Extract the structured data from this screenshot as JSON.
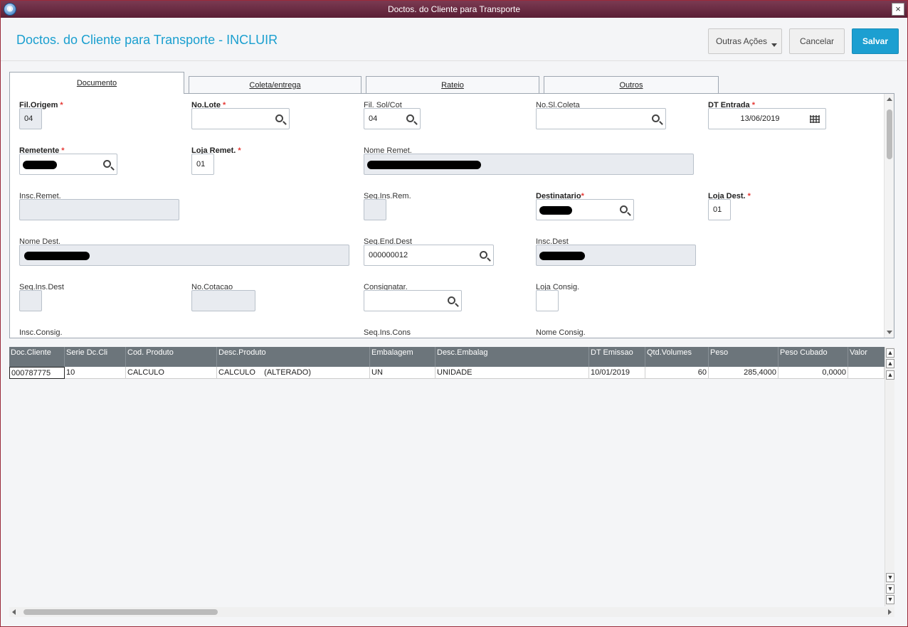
{
  "window": {
    "title": "Doctos. do Cliente para Transporte",
    "close_glyph": "×",
    "app_icon": "app-logo-icon"
  },
  "header": {
    "title": "Doctos. do Cliente para Transporte - INCLUIR",
    "buttons": {
      "more_actions": "Outras Ações",
      "cancel": "Cancelar",
      "save": "Salvar"
    }
  },
  "tabs": [
    "Documento",
    "Coleta/entrega",
    "Rateio",
    "Outros"
  ],
  "form": {
    "fil_origem": {
      "label": "Fil.Origem",
      "value": "04"
    },
    "no_lote": {
      "label": "No.Lote",
      "value": ""
    },
    "fil_sol_cot": {
      "label": "Fil. Sol/Cot",
      "value": "04"
    },
    "no_sl_coleta": {
      "label": "No.Sl.Coleta",
      "value": ""
    },
    "dt_entrada": {
      "label": "DT Entrada",
      "value": "13/06/2019"
    },
    "remetente": {
      "label": "Remetente"
    },
    "loja_remet": {
      "label": "Loja Remet.",
      "value": "01"
    },
    "nome_remet": {
      "label": "Nome Remet."
    },
    "insc_remet": {
      "label": "Insc.Remet."
    },
    "seq_ins_rem": {
      "label": "Seq.Ins.Rem."
    },
    "destinatario": {
      "label": "Destinatario"
    },
    "loja_dest": {
      "label": "Loja Dest.",
      "value": "01"
    },
    "nome_dest": {
      "label": "Nome Dest."
    },
    "seq_end_dest": {
      "label": "Seq.End.Dest",
      "value": "000000012"
    },
    "insc_dest": {
      "label": "Insc.Dest"
    },
    "seq_ins_dest": {
      "label": "Seq.Ins.Dest"
    },
    "no_cotacao": {
      "label": "No.Cotacao"
    },
    "consignatar": {
      "label": "Consignatar.",
      "value": ""
    },
    "loja_consig": {
      "label": "Loja Consig.",
      "value": ""
    },
    "insc_consig": {
      "label": "Insc.Consig."
    },
    "seq_ins_cons": {
      "label": "Seq.Ins.Cons"
    },
    "nome_consig": {
      "label": "Nome Consig."
    },
    "required_mark": "*"
  },
  "grid": {
    "columns": [
      "Doc.Cliente",
      "Serie Dc.Cli",
      "Cod. Produto",
      "Desc.Produto",
      "Embalagem",
      "Desc.Embalag",
      "DT Emissao",
      "Qtd.Volumes",
      "Peso",
      "Peso Cubado",
      "Valor"
    ],
    "rows": [
      [
        "000787775",
        "10",
        "CALCULO",
        "CALCULO    (ALTERADO)",
        "UN",
        "UNIDADE",
        "10/01/2019",
        "60",
        "285,4000",
        "0,0000",
        ""
      ]
    ]
  }
}
